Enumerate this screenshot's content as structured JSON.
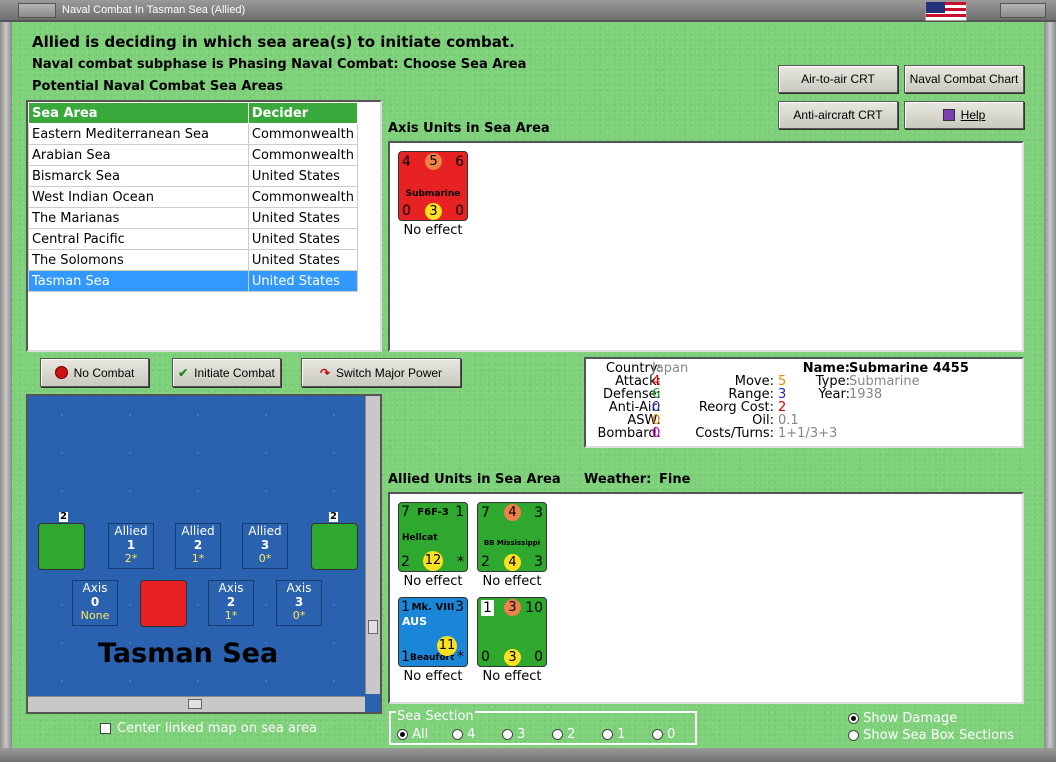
{
  "window": {
    "title": "Naval Combat In Tasman Sea (Allied)"
  },
  "header": {
    "line1": "Allied is deciding in which sea area(s) to initiate combat.",
    "line2": "Naval combat subphase is Phasing Naval Combat: Choose Sea Area",
    "line3": "Potential Naval Combat Sea Areas"
  },
  "buttons": {
    "air_to_air": "Air-to-air CRT",
    "naval_chart": "Naval Combat Chart",
    "anti_aircraft": "Anti-aircraft CRT",
    "help": "Help",
    "no_combat": "No Combat",
    "initiate": "Initiate Combat",
    "switch": "Switch Major Power"
  },
  "sea_table": {
    "headers": [
      "Sea Area",
      "Decider"
    ],
    "rows": [
      [
        "Eastern Mediterranean Sea",
        "Commonwealth"
      ],
      [
        "Arabian Sea",
        "Commonwealth"
      ],
      [
        "Bismarck Sea",
        "United States"
      ],
      [
        "West Indian Ocean",
        "Commonwealth"
      ],
      [
        "The Marianas",
        "United States"
      ],
      [
        "Central Pacific",
        "United States"
      ],
      [
        "The Solomons",
        "United States"
      ],
      [
        "Tasman Sea",
        "United States"
      ]
    ],
    "selected_index": 7
  },
  "axis_units": {
    "heading": "Axis Units in Sea Area",
    "units": [
      {
        "name": "Submarine",
        "tl": "4",
        "tc": "5",
        "tr": "6",
        "bl": "0",
        "bc": "3",
        "br": "0",
        "result": "No effect"
      }
    ]
  },
  "info": {
    "country_label": "Country:",
    "country": "Japan",
    "attack_label": "Attack:",
    "attack": "4",
    "defense_label": "Defense:",
    "defense": "6",
    "antiair_label": "Anti-Air:",
    "antiair": "0",
    "asw_label": "ASW:",
    "asw": "0",
    "bombard_label": "Bombard:",
    "bombard": "0",
    "move_label": "Move:",
    "move": "5",
    "range_label": "Range:",
    "range": "3",
    "reorg_label": "Reorg Cost:",
    "reorg": "2",
    "oil_label": "Oil:",
    "oil": "0.1",
    "costs_label": "Costs/Turns:",
    "costs": "1+1/3+3",
    "name_label": "Name:",
    "name": "Submarine 4455",
    "type_label": "Type:",
    "type": "Submarine",
    "year_label": "Year:",
    "year": "1938"
  },
  "allied_units": {
    "heading": "Allied Units in Sea Area",
    "weather_label": "Weather:",
    "weather": "Fine",
    "units": [
      {
        "name": "F6F-3",
        "sub": "Hellcat",
        "tl": "7",
        "tr": "1",
        "bl": "2",
        "bc": "12",
        "br": "*",
        "result": "No effect"
      },
      {
        "name": "BB Mississippi",
        "tl": "7",
        "tc": "4",
        "tr": "3",
        "bl": "2",
        "bc": "4",
        "br": "3",
        "result": "No effect"
      },
      {
        "name": "Mk. VIII",
        "sub": "Beaufort",
        "nation": "AUS",
        "tl": "1",
        "tr": "3",
        "bl": "1",
        "bc": "11",
        "br": "*",
        "result": "No effect"
      },
      {
        "tl": "1",
        "tc": "3",
        "tr": "10",
        "bl": "0",
        "bc": "3",
        "br": "0",
        "result": "No effect"
      }
    ]
  },
  "map": {
    "title": "Tasman Sea",
    "allied_boxes": [
      {
        "label": "Allied",
        "num": "1",
        "val": "2*"
      },
      {
        "label": "Allied",
        "num": "2",
        "val": "1*"
      },
      {
        "label": "Allied",
        "num": "3",
        "val": "0*"
      }
    ],
    "axis_boxes": [
      {
        "label": "Axis",
        "num": "0",
        "val": "None"
      },
      {
        "label": "Axis",
        "num": "2",
        "val": "1*"
      },
      {
        "label": "Axis",
        "num": "3",
        "val": "0*"
      }
    ],
    "stack_count_left": "2",
    "stack_count_right": "2",
    "center_linked_label": "Center linked map on sea area"
  },
  "sea_section": {
    "legend": "Sea Section",
    "options": [
      "All",
      "4",
      "3",
      "2",
      "1",
      "0"
    ],
    "selected": 0
  },
  "display": {
    "show_damage": "Show Damage",
    "show_sections": "Show Sea Box Sections"
  }
}
